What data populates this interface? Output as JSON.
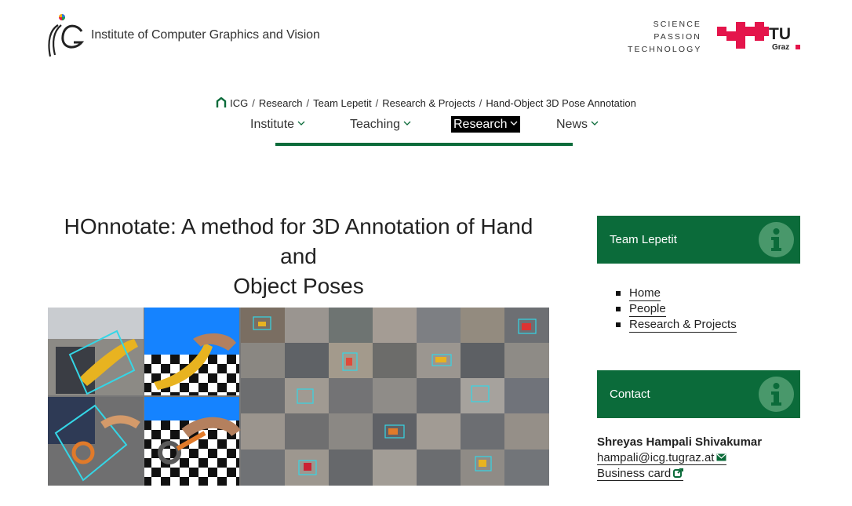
{
  "header": {
    "institute_name": "Institute of Computer Graphics and Vision",
    "tagline": [
      "SCIENCE",
      "PASSION",
      "TECHNOLOGY"
    ],
    "university_logo_text": {
      "main": "TU",
      "sub": "Graz"
    }
  },
  "breadcrumb": [
    "ICG",
    "Research",
    "Team Lepetit",
    "Research & Projects",
    "Hand-Object 3D Pose Annotation"
  ],
  "nav": {
    "items": [
      {
        "label": "Institute",
        "active": false
      },
      {
        "label": "Teaching",
        "active": false
      },
      {
        "label": "Research",
        "active": true
      },
      {
        "label": "News",
        "active": false
      }
    ]
  },
  "page": {
    "title_line1": "HOnnotate: A method for 3D Annotation of Hand and",
    "title_line2": "Object Poses"
  },
  "sidebar": {
    "team_box_label": "Team Lepetit",
    "links": [
      "Home",
      "People",
      "Research & Projects"
    ],
    "contact_box_label": "Contact",
    "contact": {
      "name": "Shreyas Hampali Shivakumar",
      "email": "hampali@icg.tugraz.at",
      "business_card": "Business card"
    }
  },
  "colors": {
    "brand_green": "#0b6b3a",
    "tu_red": "#e4154b",
    "active_nav_bg": "#000000"
  },
  "icons": {
    "home": "home-icon",
    "chevron": "chevron-down-icon",
    "info": "info-icon",
    "mail": "mail-icon",
    "external": "external-link-icon"
  }
}
